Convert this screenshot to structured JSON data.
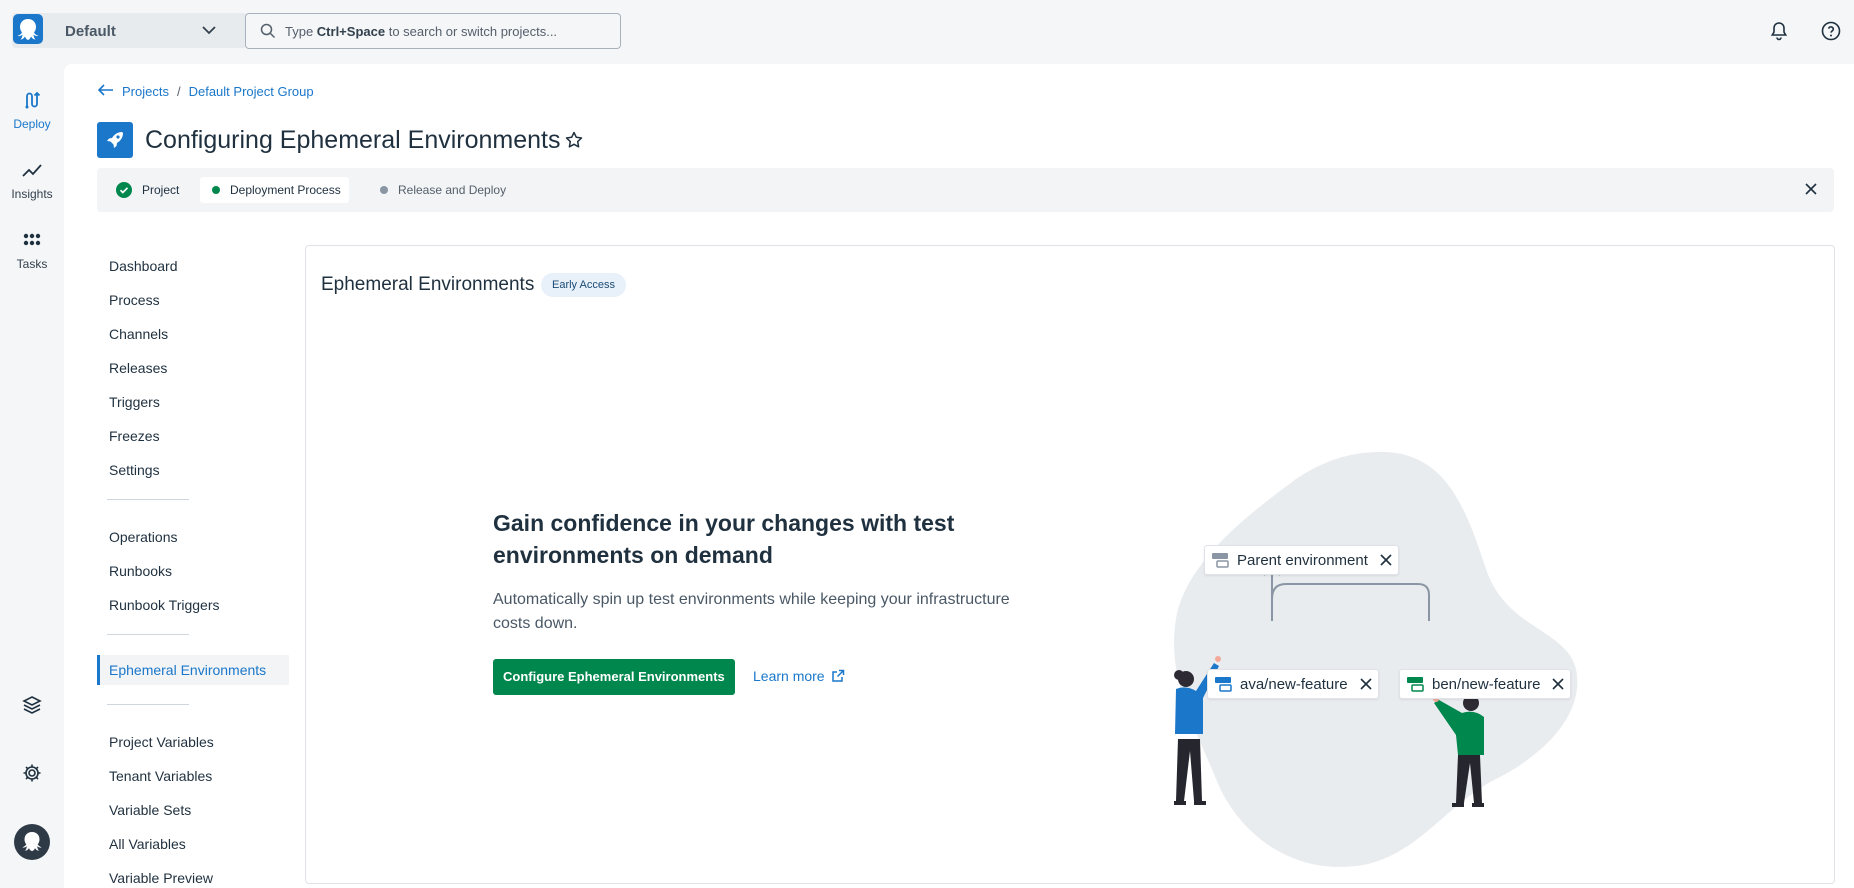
{
  "header": {
    "space_name": "Default",
    "search_placeholder_prefix": "Type ",
    "search_shortcut": "Ctrl+Space",
    "search_placeholder_suffix": " to search or switch projects..."
  },
  "nav": {
    "items": [
      {
        "label": "Deploy",
        "icon": "deploy-icon",
        "active": true
      },
      {
        "label": "Insights",
        "icon": "insights-icon"
      },
      {
        "label": "Tasks",
        "icon": "tasks-icon"
      }
    ]
  },
  "breadcrumb": {
    "projects": "Projects",
    "separator": "/",
    "group": "Default Project Group"
  },
  "page": {
    "title": "Configuring Ephemeral Environments"
  },
  "stepper": {
    "steps": [
      {
        "label": "Project",
        "state": "complete"
      },
      {
        "label": "Deployment Process",
        "state": "current"
      },
      {
        "label": "Release and Deploy",
        "state": "pending"
      }
    ]
  },
  "sidebar": {
    "items": [
      "Dashboard",
      "Process",
      "Channels",
      "Releases",
      "Triggers",
      "Freezes",
      "Settings",
      "Operations",
      "Runbooks",
      "Runbook Triggers",
      "Ephemeral Environments",
      "Project Variables",
      "Tenant Variables",
      "Variable Sets",
      "All Variables",
      "Variable Preview"
    ],
    "active": "Ephemeral Environments"
  },
  "content": {
    "title": "Ephemeral Environments",
    "badge": "Early Access",
    "hero_title": "Gain confidence in your changes with test environments on demand",
    "hero_text": "Automatically spin up test environments while keeping your infrastructure costs down.",
    "cta_label": "Configure Ephemeral Environments",
    "learn_more": "Learn more",
    "illustration": {
      "parent_env": "Parent environment",
      "branch_a": "ava/new-feature",
      "branch_b": "ben/new-feature"
    }
  },
  "colors": {
    "accent": "#1a77ca",
    "success": "#00874d",
    "background": "#f4f6f8"
  }
}
